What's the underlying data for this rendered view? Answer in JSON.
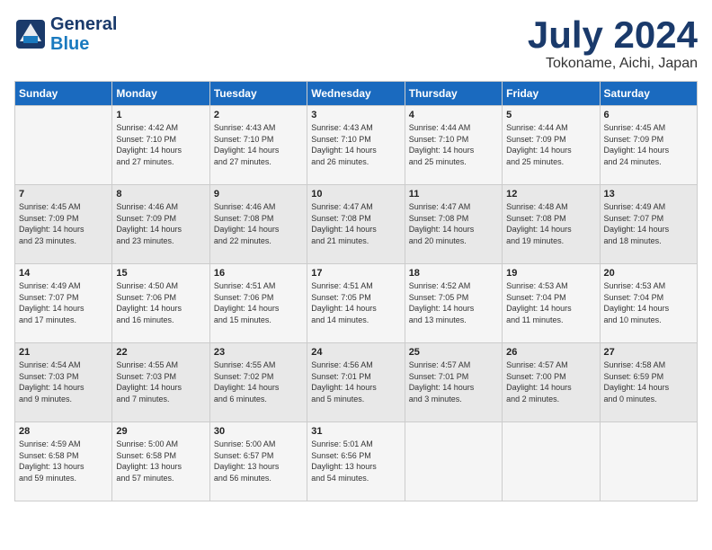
{
  "header": {
    "logo_line1": "General",
    "logo_line2": "Blue",
    "month": "July 2024",
    "location": "Tokoname, Aichi, Japan"
  },
  "weekdays": [
    "Sunday",
    "Monday",
    "Tuesday",
    "Wednesday",
    "Thursday",
    "Friday",
    "Saturday"
  ],
  "weeks": [
    [
      {
        "day": "",
        "info": ""
      },
      {
        "day": "1",
        "info": "Sunrise: 4:42 AM\nSunset: 7:10 PM\nDaylight: 14 hours\nand 27 minutes."
      },
      {
        "day": "2",
        "info": "Sunrise: 4:43 AM\nSunset: 7:10 PM\nDaylight: 14 hours\nand 27 minutes."
      },
      {
        "day": "3",
        "info": "Sunrise: 4:43 AM\nSunset: 7:10 PM\nDaylight: 14 hours\nand 26 minutes."
      },
      {
        "day": "4",
        "info": "Sunrise: 4:44 AM\nSunset: 7:10 PM\nDaylight: 14 hours\nand 25 minutes."
      },
      {
        "day": "5",
        "info": "Sunrise: 4:44 AM\nSunset: 7:09 PM\nDaylight: 14 hours\nand 25 minutes."
      },
      {
        "day": "6",
        "info": "Sunrise: 4:45 AM\nSunset: 7:09 PM\nDaylight: 14 hours\nand 24 minutes."
      }
    ],
    [
      {
        "day": "7",
        "info": "Sunrise: 4:45 AM\nSunset: 7:09 PM\nDaylight: 14 hours\nand 23 minutes."
      },
      {
        "day": "8",
        "info": "Sunrise: 4:46 AM\nSunset: 7:09 PM\nDaylight: 14 hours\nand 23 minutes."
      },
      {
        "day": "9",
        "info": "Sunrise: 4:46 AM\nSunset: 7:08 PM\nDaylight: 14 hours\nand 22 minutes."
      },
      {
        "day": "10",
        "info": "Sunrise: 4:47 AM\nSunset: 7:08 PM\nDaylight: 14 hours\nand 21 minutes."
      },
      {
        "day": "11",
        "info": "Sunrise: 4:47 AM\nSunset: 7:08 PM\nDaylight: 14 hours\nand 20 minutes."
      },
      {
        "day": "12",
        "info": "Sunrise: 4:48 AM\nSunset: 7:08 PM\nDaylight: 14 hours\nand 19 minutes."
      },
      {
        "day": "13",
        "info": "Sunrise: 4:49 AM\nSunset: 7:07 PM\nDaylight: 14 hours\nand 18 minutes."
      }
    ],
    [
      {
        "day": "14",
        "info": "Sunrise: 4:49 AM\nSunset: 7:07 PM\nDaylight: 14 hours\nand 17 minutes."
      },
      {
        "day": "15",
        "info": "Sunrise: 4:50 AM\nSunset: 7:06 PM\nDaylight: 14 hours\nand 16 minutes."
      },
      {
        "day": "16",
        "info": "Sunrise: 4:51 AM\nSunset: 7:06 PM\nDaylight: 14 hours\nand 15 minutes."
      },
      {
        "day": "17",
        "info": "Sunrise: 4:51 AM\nSunset: 7:05 PM\nDaylight: 14 hours\nand 14 minutes."
      },
      {
        "day": "18",
        "info": "Sunrise: 4:52 AM\nSunset: 7:05 PM\nDaylight: 14 hours\nand 13 minutes."
      },
      {
        "day": "19",
        "info": "Sunrise: 4:53 AM\nSunset: 7:04 PM\nDaylight: 14 hours\nand 11 minutes."
      },
      {
        "day": "20",
        "info": "Sunrise: 4:53 AM\nSunset: 7:04 PM\nDaylight: 14 hours\nand 10 minutes."
      }
    ],
    [
      {
        "day": "21",
        "info": "Sunrise: 4:54 AM\nSunset: 7:03 PM\nDaylight: 14 hours\nand 9 minutes."
      },
      {
        "day": "22",
        "info": "Sunrise: 4:55 AM\nSunset: 7:03 PM\nDaylight: 14 hours\nand 7 minutes."
      },
      {
        "day": "23",
        "info": "Sunrise: 4:55 AM\nSunset: 7:02 PM\nDaylight: 14 hours\nand 6 minutes."
      },
      {
        "day": "24",
        "info": "Sunrise: 4:56 AM\nSunset: 7:01 PM\nDaylight: 14 hours\nand 5 minutes."
      },
      {
        "day": "25",
        "info": "Sunrise: 4:57 AM\nSunset: 7:01 PM\nDaylight: 14 hours\nand 3 minutes."
      },
      {
        "day": "26",
        "info": "Sunrise: 4:57 AM\nSunset: 7:00 PM\nDaylight: 14 hours\nand 2 minutes."
      },
      {
        "day": "27",
        "info": "Sunrise: 4:58 AM\nSunset: 6:59 PM\nDaylight: 14 hours\nand 0 minutes."
      }
    ],
    [
      {
        "day": "28",
        "info": "Sunrise: 4:59 AM\nSunset: 6:58 PM\nDaylight: 13 hours\nand 59 minutes."
      },
      {
        "day": "29",
        "info": "Sunrise: 5:00 AM\nSunset: 6:58 PM\nDaylight: 13 hours\nand 57 minutes."
      },
      {
        "day": "30",
        "info": "Sunrise: 5:00 AM\nSunset: 6:57 PM\nDaylight: 13 hours\nand 56 minutes."
      },
      {
        "day": "31",
        "info": "Sunrise: 5:01 AM\nSunset: 6:56 PM\nDaylight: 13 hours\nand 54 minutes."
      },
      {
        "day": "",
        "info": ""
      },
      {
        "day": "",
        "info": ""
      },
      {
        "day": "",
        "info": ""
      }
    ]
  ]
}
